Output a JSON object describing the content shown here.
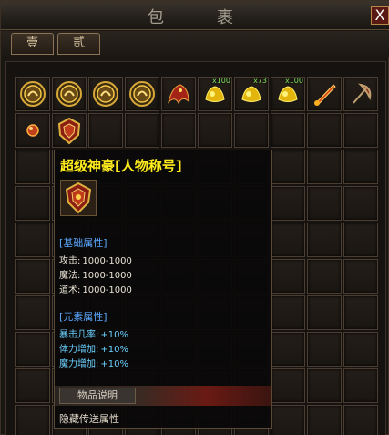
{
  "window": {
    "title_left": "包",
    "title_right": "裹",
    "close_label": "X"
  },
  "tabs": [
    {
      "label": "壹"
    },
    {
      "label": "贰"
    }
  ],
  "slots_row1_counts": [
    "",
    "",
    "",
    "",
    "",
    "x100",
    "x73",
    "x100",
    "",
    ""
  ],
  "tooltip": {
    "title": "超级神豪[人物称号]",
    "section_base": "[基础属性]",
    "base_stats": [
      {
        "label": "攻击:",
        "value": "1000-1000"
      },
      {
        "label": "魔法:",
        "value": "1000-1000"
      },
      {
        "label": "道术:",
        "value": "1000-1000"
      }
    ],
    "section_element": "[元素属性]",
    "element_stats": [
      {
        "label": "暴击几率:",
        "value": "+10%"
      },
      {
        "label": "体力增加:",
        "value": "+10%"
      },
      {
        "label": "魔力增加:",
        "value": "+10%"
      }
    ],
    "desc_label": "物品说明",
    "desc_text": "隐藏传送属性"
  },
  "colors": {
    "title_yellow": "#ffec1c",
    "section_blue": "#5aa8ff",
    "element_cyan": "#6ad0ff",
    "count_green": "#7ee05a",
    "close_red": "#5a1a14"
  }
}
